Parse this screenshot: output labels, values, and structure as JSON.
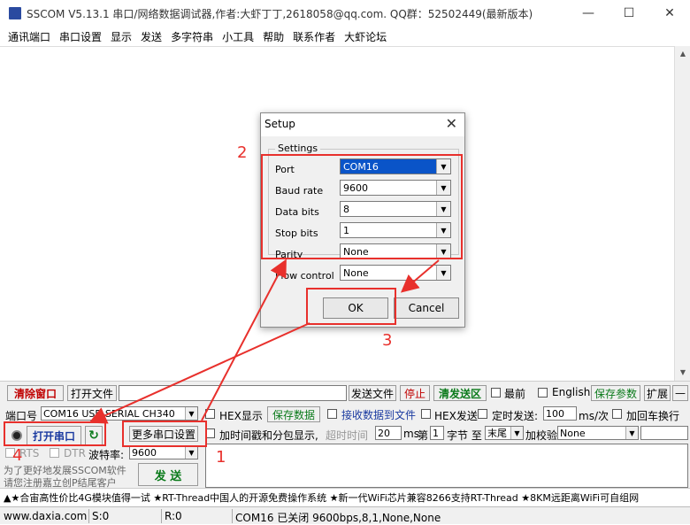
{
  "window": {
    "title": "SSCOM V5.13.1 串口/网络数据调试器,作者:大虾丁丁,2618058@qq.com. QQ群：52502449(最新版本)"
  },
  "menu": [
    "通讯端口",
    "串口设置",
    "显示",
    "发送",
    "多字符串",
    "小工具",
    "帮助",
    "联系作者",
    "大虾论坛"
  ],
  "toolbar_row1": {
    "clear_window": "清除窗口",
    "open_file": "打开文件",
    "send_file": "发送文件",
    "stop": "停止",
    "clear_send": "清发送区",
    "topmost": "最前",
    "english": "English",
    "save_params": "保存参数",
    "expand": "扩展",
    "minus": "—"
  },
  "toolbar_row2": {
    "port_label": "端口号",
    "port_value": "COM16 USB-SERIAL CH340",
    "hex_display": "HEX显示",
    "save_data": "保存数据",
    "recv_to_file": "接收数据到文件",
    "hex_send": "HEX发送",
    "timed_send": "定时发送:",
    "interval": "100",
    "interval_unit": "ms/次",
    "add_crlf": "加回车换行"
  },
  "toolbar_row3": {
    "open_port": "打开串口",
    "more_settings": "更多串口设置",
    "timestamp_label": "加时间戳和分包显示,",
    "timeout_label": "超时时间",
    "timeout_value": "20",
    "ms": "ms",
    "nth": "第",
    "byte_index": "1",
    "byte_unit": "字节 至",
    "end_select": "末尾",
    "checksum_label": "加校验",
    "checksum_value": "None"
  },
  "toolbar_row4": {
    "rts": "RTS",
    "dtr": "DTR",
    "baud_label": "波特率:",
    "baud_value": "9600",
    "promo_line1": "为了更好地发展SSCOM软件",
    "promo_line2": "请您注册嘉立创P结尾客户",
    "send_button": "发  送"
  },
  "ticker": "▲★合宙高性价比4G模块值得一试 ★RT-Thread中国人的开源免费操作系统 ★新一代WiFi芯片兼容8266支持RT-Thread ★8KM远距离WiFi可自组网",
  "statusbar": {
    "website": "www.daxia.com",
    "sent": "S:0",
    "received": "R:0",
    "port_state": "COM16 已关闭  9600bps,8,1,None,None"
  },
  "dialog": {
    "title": "Setup",
    "group_label": "Settings",
    "fields": [
      {
        "label": "Port",
        "value": "COM16"
      },
      {
        "label": "Baud rate",
        "value": "9600"
      },
      {
        "label": "Data bits",
        "value": "8"
      },
      {
        "label": "Stop bits",
        "value": "1"
      },
      {
        "label": "Parity",
        "value": "None"
      },
      {
        "label": "Flow control",
        "value": "None"
      }
    ],
    "ok": "OK",
    "cancel": "Cancel"
  },
  "annotations": {
    "step1": "1",
    "step2": "2",
    "step3": "3",
    "step4": "4",
    "color": "#e8302c"
  },
  "colors": {
    "accent_red": "#c00000",
    "accent_green": "#0a7a1a",
    "selection_blue": "#0a54c8"
  }
}
